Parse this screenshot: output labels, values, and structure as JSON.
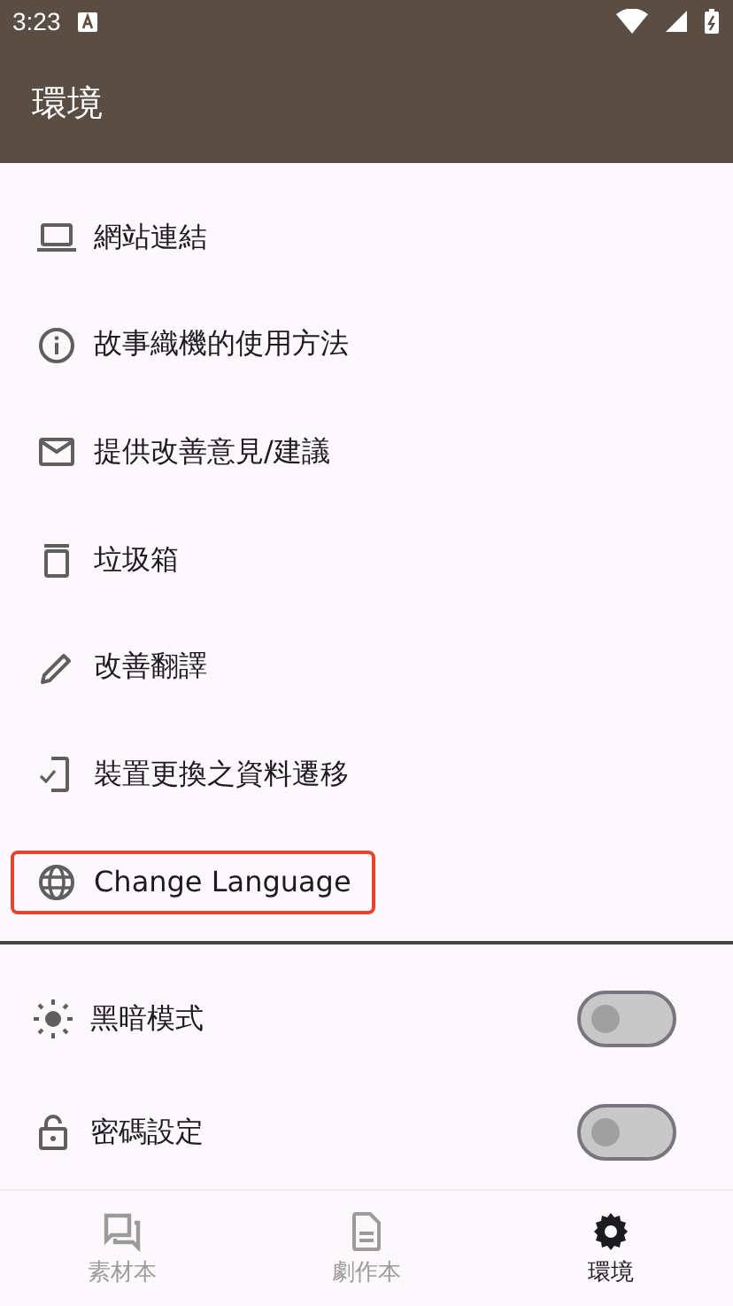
{
  "status_bar": {
    "time": "3:23"
  },
  "app_bar": {
    "title": "環境"
  },
  "menu": [
    {
      "kind": "link",
      "label": "網站連結",
      "highlighted": false
    },
    {
      "kind": "link",
      "label": "故事織機的使用方法",
      "highlighted": false
    },
    {
      "kind": "link",
      "label": "提供改善意見/建議",
      "highlighted": false
    },
    {
      "kind": "link",
      "label": "垃圾箱",
      "highlighted": false
    },
    {
      "kind": "link",
      "label": "改善翻譯",
      "highlighted": false
    },
    {
      "kind": "link",
      "label": "裝置更換之資料遷移",
      "highlighted": false
    },
    {
      "kind": "link",
      "label": "Change Language",
      "highlighted": true
    }
  ],
  "settings": [
    {
      "kind": "toggle",
      "label": "黑暗模式",
      "on": false
    },
    {
      "kind": "toggle",
      "label": "密碼設定",
      "on": false
    }
  ],
  "bottom_nav": [
    {
      "label": "素材本",
      "selected": false
    },
    {
      "label": "劇作本",
      "selected": false
    },
    {
      "label": "環境",
      "selected": true
    }
  ]
}
